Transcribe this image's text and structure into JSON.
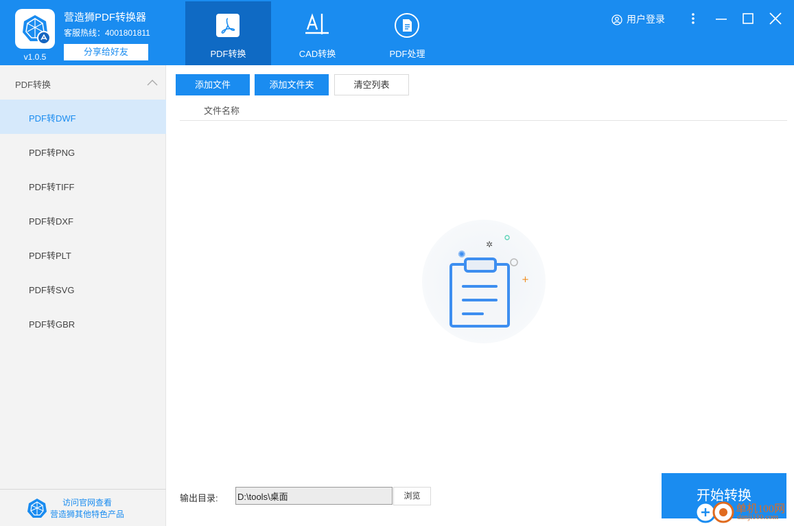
{
  "app": {
    "name": "营造狮PDF转换器",
    "hotline": "客服热线：4001801811",
    "share_label": "分享给好友",
    "version": "v1.0.5"
  },
  "nav": {
    "tabs": [
      {
        "label": "PDF转换",
        "icon": "pdf-icon",
        "active": true
      },
      {
        "label": "CAD转换",
        "icon": "cad-icon",
        "active": false
      },
      {
        "label": "PDF处理",
        "icon": "document-icon",
        "active": false
      }
    ]
  },
  "user": {
    "login_label": "用户登录"
  },
  "sidebar": {
    "section_title": "PDF转换",
    "items": [
      {
        "label": "PDF转DWF",
        "active": true
      },
      {
        "label": "PDF转PNG",
        "active": false
      },
      {
        "label": "PDF转TIFF",
        "active": false
      },
      {
        "label": "PDF转DXF",
        "active": false
      },
      {
        "label": "PDF转PLT",
        "active": false
      },
      {
        "label": "PDF转SVG",
        "active": false
      },
      {
        "label": "PDF转GBR",
        "active": false
      }
    ],
    "footer_line1": "访问官网查看",
    "footer_line2": "营造狮其他特色产品"
  },
  "toolbar": {
    "add_file": "添加文件",
    "add_folder": "添加文件夹",
    "clear_list": "清空列表"
  },
  "file_list": {
    "column_name": "文件名称",
    "rows": []
  },
  "output": {
    "label": "输出目录:",
    "path": "D:\\tools\\桌面",
    "browse_label": "浏览"
  },
  "start_label": "开始转换",
  "watermark": {
    "line1": "单机100网",
    "line2": "danji100.com"
  },
  "colors": {
    "accent": "#1a8cf0",
    "accent_dark": "#0f6ac4",
    "sidebar_bg": "#f3f3f3",
    "sidebar_active": "#d6e9fb",
    "watermark": "#e06b1f"
  }
}
